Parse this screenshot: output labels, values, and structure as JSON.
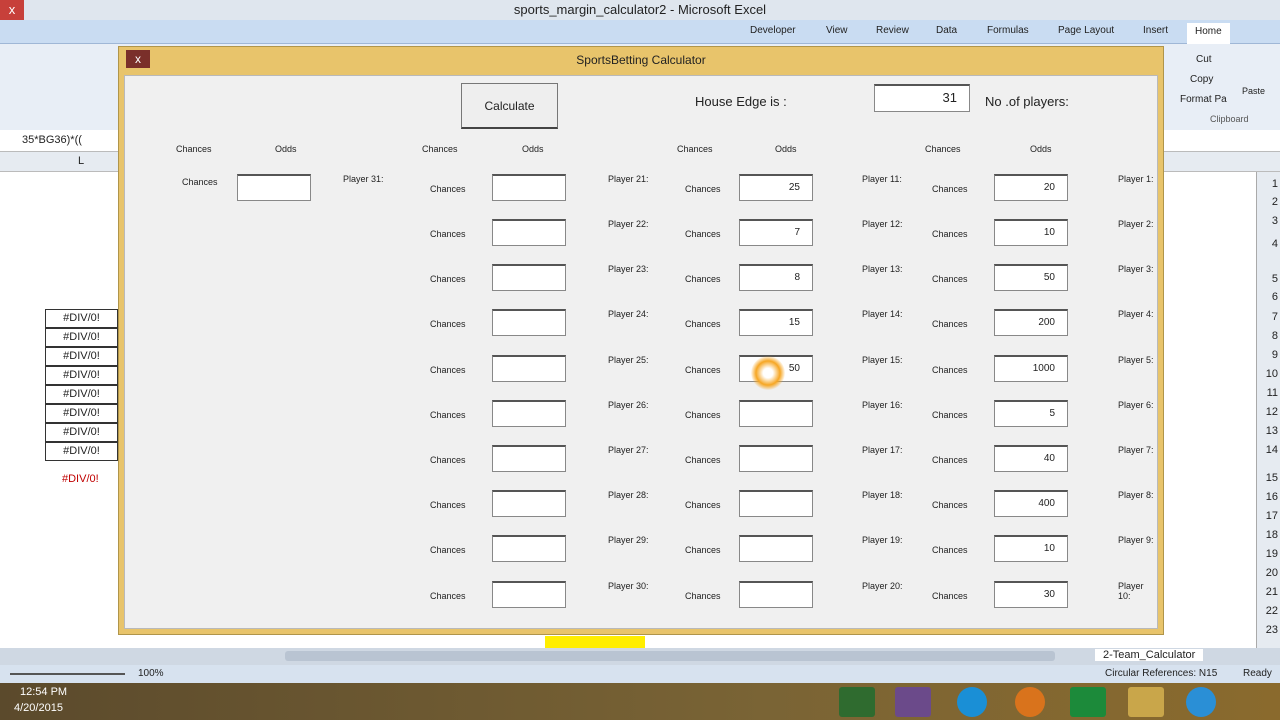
{
  "window": {
    "title": "sports_margin_calculator2 - Microsoft Excel"
  },
  "ribbon": {
    "tabs": [
      "Home",
      "Insert",
      "Page Layout",
      "Formulas",
      "Data",
      "Review",
      "View",
      "Developer"
    ],
    "clipboard": {
      "cut": "Cut",
      "copy": "Copy",
      "format_painter": "Format Pa",
      "paste": "Paste",
      "group": "Clipboard"
    }
  },
  "formula_bar": {
    "text": "35*BG36)*(("
  },
  "sheet": {
    "column_letter": "L",
    "div_values": [
      "#DIV/0!",
      "#DIV/0!",
      "#DIV/0!",
      "#DIV/0!",
      "#DIV/0!",
      "#DIV/0!",
      "#DIV/0!",
      "#DIV/0!"
    ],
    "div_red": "#DIV/0!",
    "row_numbers": [
      "1",
      "2",
      "3",
      "4",
      "5",
      "6",
      "7",
      "8",
      "9",
      "10",
      "11",
      "12",
      "13",
      "14",
      "15",
      "16",
      "17",
      "18",
      "19",
      "20",
      "21",
      "22",
      "23"
    ],
    "tab": "2-Team_Calculator"
  },
  "status": {
    "ready": "Ready",
    "circular": "Circular References: N15",
    "zoom": "100%"
  },
  "clock": {
    "time": "12:54 PM",
    "date": "4/20/2015"
  },
  "dialog": {
    "title": "SportsBetting Calculator",
    "close": "x",
    "players_label": "No .of players:",
    "players_value": "31",
    "house_edge_label": "House Edge is :",
    "calculate": "Calculate",
    "odds_header": "Odds",
    "chances_header": "Chances",
    "chances_label": "Chances",
    "columns": [
      {
        "players": [
          {
            "label": "Player 1:",
            "odds": "20"
          },
          {
            "label": "Player 2:",
            "odds": "10"
          },
          {
            "label": "Player 3:",
            "odds": "50"
          },
          {
            "label": "Player 4:",
            "odds": "200"
          },
          {
            "label": "Player 5:",
            "odds": "1000"
          },
          {
            "label": "Player 6:",
            "odds": "5"
          },
          {
            "label": "Player 7:",
            "odds": "40"
          },
          {
            "label": "Player 8:",
            "odds": "400"
          },
          {
            "label": "Player 9:",
            "odds": "10"
          },
          {
            "label": "Player 10:",
            "odds": "30"
          }
        ]
      },
      {
        "players": [
          {
            "label": "Player 11:",
            "odds": "25"
          },
          {
            "label": "Player 12:",
            "odds": "7"
          },
          {
            "label": "Player 13:",
            "odds": "8"
          },
          {
            "label": "Player 14:",
            "odds": "15"
          },
          {
            "label": "Player 15:",
            "odds": "50"
          },
          {
            "label": "Player 16:",
            "odds": ""
          },
          {
            "label": "Player 17:",
            "odds": ""
          },
          {
            "label": "Player 18:",
            "odds": ""
          },
          {
            "label": "Player 19:",
            "odds": ""
          },
          {
            "label": "Player 20:",
            "odds": ""
          }
        ]
      },
      {
        "players": [
          {
            "label": "Player 21:",
            "odds": ""
          },
          {
            "label": "Player 22:",
            "odds": ""
          },
          {
            "label": "Player 23:",
            "odds": ""
          },
          {
            "label": "Player 24:",
            "odds": ""
          },
          {
            "label": "Player 25:",
            "odds": ""
          },
          {
            "label": "Player 26:",
            "odds": ""
          },
          {
            "label": "Player 27:",
            "odds": ""
          },
          {
            "label": "Player 28:",
            "odds": ""
          },
          {
            "label": "Player 29:",
            "odds": ""
          },
          {
            "label": "Player 30:",
            "odds": ""
          }
        ]
      },
      {
        "players": [
          {
            "label": "Player 31:",
            "odds": ""
          }
        ]
      }
    ]
  }
}
